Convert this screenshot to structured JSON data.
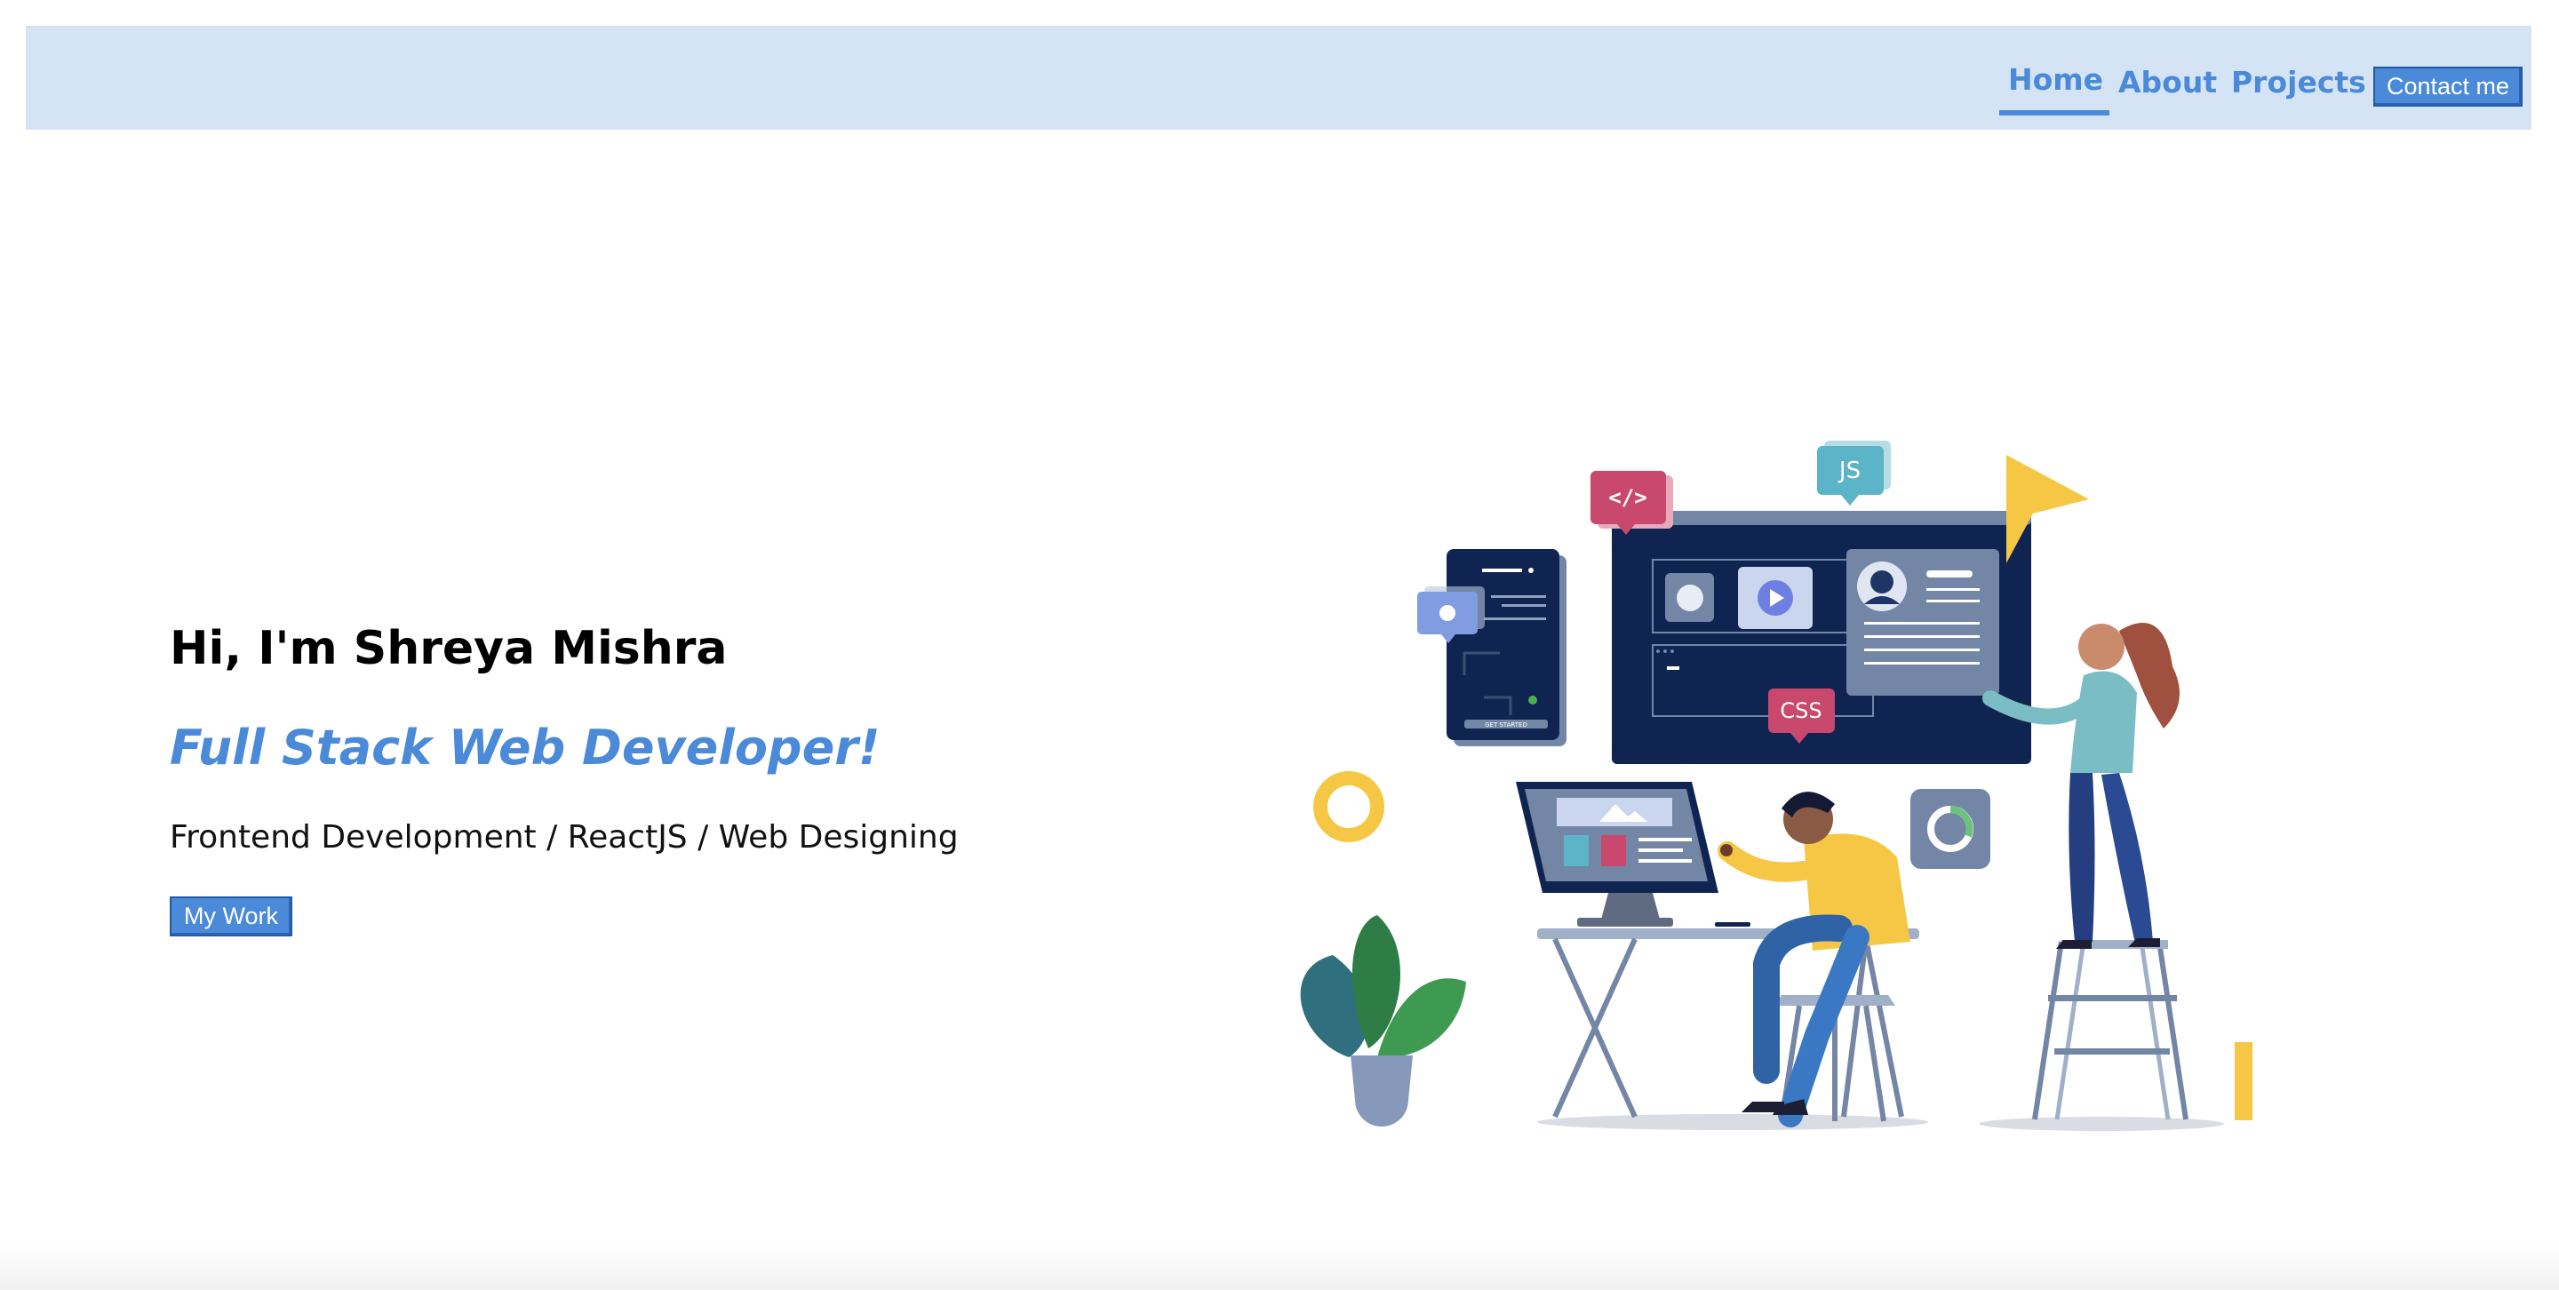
{
  "nav": {
    "home_label": "Home",
    "about_label": "About",
    "projects_label": "Projects",
    "contact_label": "Contact me"
  },
  "hero": {
    "greeting": "Hi, I'm Shreya Mishra",
    "role": "Full Stack Web Developer!",
    "skills": "Frontend Development / ReactJS / Web Designing",
    "cta_label": "My Work"
  },
  "illustration": {
    "tags": {
      "code": "</>",
      "js": "JS",
      "css": "CSS",
      "get_started": "GET STARTED"
    }
  },
  "colors": {
    "accent": "#4a8ad8",
    "navbar_bg": "#d4e4f4",
    "dark_navy": "#0f2450",
    "yellow": "#f6c744",
    "pink": "#c8486e",
    "teal": "#5bb4c8"
  }
}
